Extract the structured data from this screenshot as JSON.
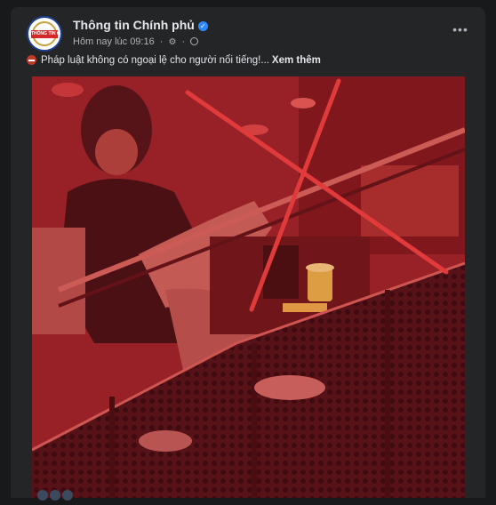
{
  "post": {
    "page_name": "Thông tin Chính phủ",
    "avatar_text": "THÔNG TIN CHÍNH PHỦ",
    "timestamp": "Hôm nay lúc 09:16",
    "separator": "·",
    "caption": "Pháp luật không có ngoại lệ cho người nổi tiếng!...",
    "see_more": "Xem thêm",
    "more_options": "•••"
  },
  "photo": {
    "description_icon": "photo",
    "overlay_color": "#c0262e",
    "cross_color": "#e03a3a"
  },
  "icons": {
    "verified": "verified-badge-icon",
    "privacy": "globe-icon",
    "settings": "gear-icon",
    "warning": "no-entry-icon",
    "menu": "more-options-icon"
  }
}
